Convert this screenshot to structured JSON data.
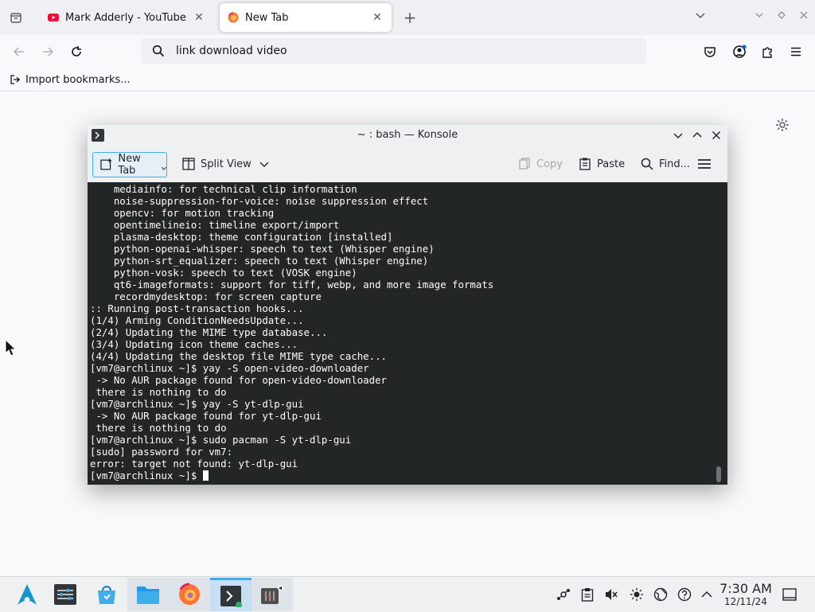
{
  "browser": {
    "tabs": [
      {
        "title": "Mark Adderly - YouTube",
        "active": false
      },
      {
        "title": "New Tab",
        "active": true
      }
    ],
    "new_tab_symbol": "+",
    "url": "link download video",
    "bookmarks_bar": {
      "import_label": "Import bookmarks..."
    }
  },
  "konsole": {
    "title": "~ : bash — Konsole",
    "toolbar": {
      "new_tab": "New Tab",
      "split_view": "Split View",
      "copy": "Copy",
      "paste": "Paste",
      "find": "Find..."
    },
    "terminal_lines": [
      "    mediainfo: for technical clip information",
      "    noise-suppression-for-voice: noise suppression effect",
      "    opencv: for motion tracking",
      "    opentimelineio: timeline export/import",
      "    plasma-desktop: theme configuration [installed]",
      "    python-openai-whisper: speech to text (Whisper engine)",
      "    python-srt_equalizer: speech to text (Whisper engine)",
      "    python-vosk: speech to text (VOSK engine)",
      "    qt6-imageformats: support for tiff, webp, and more image formats",
      "    recordmydesktop: for screen capture",
      ":: Running post-transaction hooks...",
      "(1/4) Arming ConditionNeedsUpdate...",
      "(2/4) Updating the MIME type database...",
      "(3/4) Updating icon theme caches...",
      "(4/4) Updating the desktop file MIME type cache...",
      "[vm7@archlinux ~]$ yay -S open-video-downloader",
      " -> No AUR package found for open-video-downloader",
      " there is nothing to do",
      "[vm7@archlinux ~]$ yay -S yt-dlp-gui",
      " -> No AUR package found for yt-dlp-gui",
      " there is nothing to do",
      "[vm7@archlinux ~]$ sudo pacman -S yt-dlp-gui",
      "[sudo] password for vm7:",
      "error: target not found: yt-dlp-gui"
    ],
    "prompt": "[vm7@archlinux ~]$ "
  },
  "taskbar": {
    "clock_time": "7:30 AM",
    "clock_date": "12/11/24"
  },
  "colors": {
    "accent": "#3daee9",
    "terminal_bg": "#232627",
    "terminal_fg": "#fcfcfc",
    "youtube_red": "#ff0033"
  },
  "icons": [
    "tab-list-icon",
    "youtube-favicon",
    "firefox-favicon",
    "close-icon",
    "plus-icon",
    "chevron-down-icon",
    "minimize-icon",
    "restore-icon",
    "back-icon",
    "forward-icon",
    "reload-icon",
    "search-icon",
    "pocket-icon",
    "account-icon",
    "extensions-icon",
    "menu-icon",
    "import-icon",
    "gear-icon",
    "konsole-icon",
    "new-tab-icon",
    "split-view-icon",
    "copy-icon",
    "paste-icon",
    "find-icon",
    "hamburger-icon",
    "arch-logo-icon",
    "system-settings-icon",
    "discover-icon",
    "dolphin-icon",
    "firefox-icon",
    "konsole-icon",
    "audio-mixer-icon",
    "network-icon",
    "clipboard-icon",
    "volume-muted-icon",
    "brightness-icon",
    "globe-icon",
    "help-icon",
    "chevron-up-icon",
    "show-desktop-icon"
  ]
}
